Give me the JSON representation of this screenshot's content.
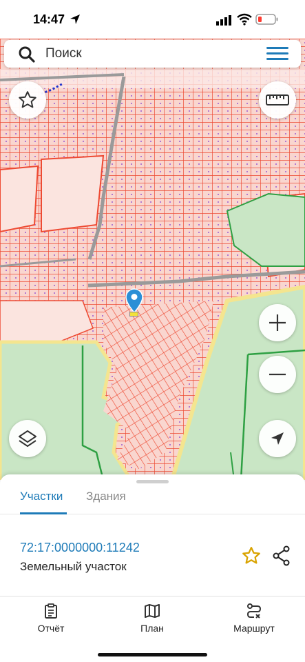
{
  "status_bar": {
    "time": "14:47",
    "icons": [
      "location-arrow-icon",
      "cellular-signal-icon",
      "wifi-icon",
      "battery-low-icon"
    ]
  },
  "search": {
    "placeholder": "Поиск",
    "icon": "search-icon",
    "menu_icon": "hamburger-menu-icon"
  },
  "map": {
    "controls": [
      "star-icon",
      "ruler-icon",
      "zoom-in-icon",
      "zoom-out-icon",
      "layers-icon",
      "locate-arrow-icon"
    ],
    "colors": {
      "parcel_fill": "#f9d6cf",
      "parcel_border": "#ee4a33",
      "green_area": "#c9e6c5",
      "green_border": "#2ea043",
      "road": "#9a9a9a"
    },
    "marker_icon": "map-pin-icon"
  },
  "sheet": {
    "tabs": [
      {
        "label": "Участки",
        "active": true
      },
      {
        "label": "Здания",
        "active": false
      }
    ],
    "parcel": {
      "number": "72:17:0000000:11242",
      "type": "Земельный участок"
    },
    "actions": [
      "star-outline-icon",
      "share-icon"
    ]
  },
  "nav": {
    "items": [
      {
        "label": "Отчёт",
        "icon": "clipboard-icon"
      },
      {
        "label": "План",
        "icon": "map-book-icon"
      },
      {
        "label": "Маршрут",
        "icon": "route-icon"
      }
    ]
  },
  "accent_color": "#1e7bb8"
}
